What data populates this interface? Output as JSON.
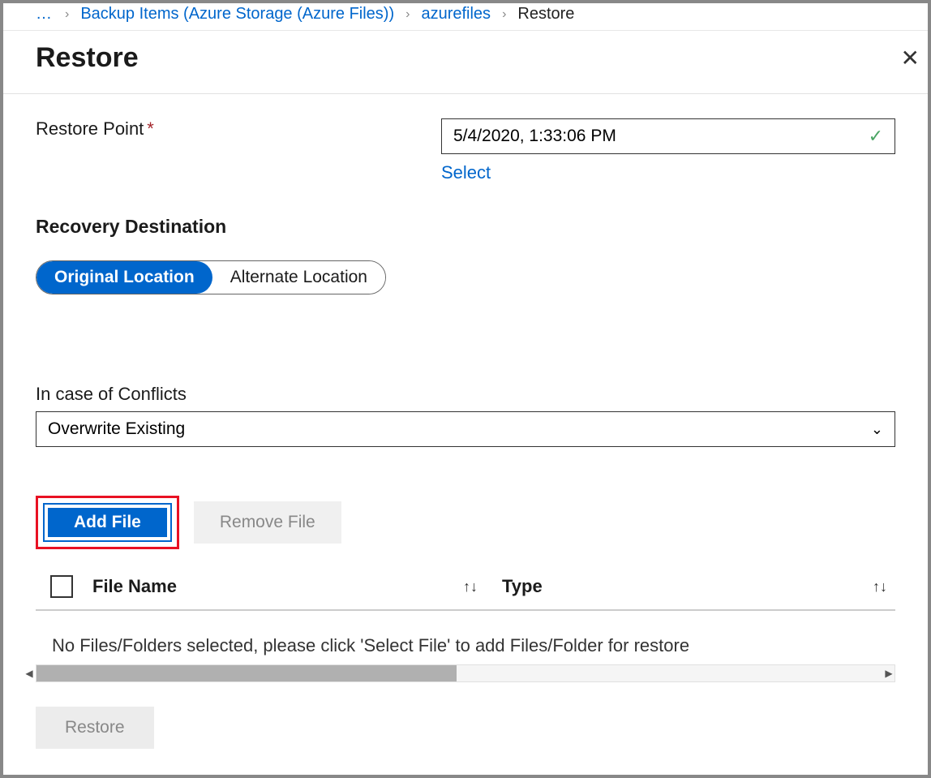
{
  "breadcrumb": {
    "ellipsis": "…",
    "items": [
      {
        "label": "Backup Items (Azure Storage (Azure Files))",
        "link": true
      },
      {
        "label": "azurefiles",
        "link": true
      },
      {
        "label": "Restore",
        "link": false
      }
    ]
  },
  "header": {
    "title": "Restore"
  },
  "restorePoint": {
    "label": "Restore Point",
    "value": "5/4/2020, 1:33:06 PM",
    "selectLink": "Select"
  },
  "recovery": {
    "sectionLabel": "Recovery Destination",
    "options": {
      "original": "Original Location",
      "alternate": "Alternate Location"
    }
  },
  "conflicts": {
    "label": "In case of Conflicts",
    "selected": "Overwrite Existing"
  },
  "files": {
    "addButton": "Add File",
    "removeButton": "Remove File",
    "columns": {
      "fileName": "File Name",
      "type": "Type"
    },
    "emptyMessage": "No Files/Folders selected, please click 'Select File' to add Files/Folder for restore"
  },
  "footer": {
    "restoreButton": "Restore"
  }
}
